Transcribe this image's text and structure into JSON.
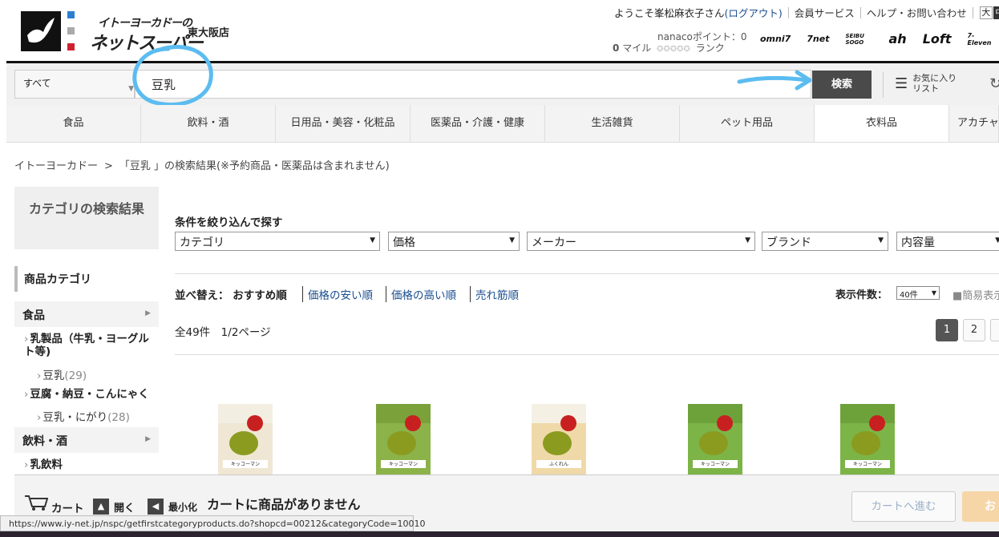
{
  "header": {
    "logo_line1": "イトーヨーカドーの",
    "logo_line2": "ネットスーパー",
    "store": "東大阪店",
    "welcome": "ようこそ峯松麻衣子さん",
    "logout": "(ログアウト)",
    "member": "会員サービス",
    "help": "ヘルプ・お問い合わせ",
    "font_large": "大",
    "font_medium": "中",
    "nanaco": "nanacoポイント：0",
    "miles_value": "0",
    "miles_unit": "マイル",
    "rank": "ランク",
    "partners": [
      "omni7",
      "7net",
      "SEIBU SOGO",
      "ah",
      "Loft",
      "7-Eleven"
    ]
  },
  "search": {
    "scope": "すべて",
    "query": "豆乳",
    "button": "検索",
    "fav_line1": "お気に入り",
    "fav_line2": "リスト"
  },
  "categories": [
    "食品",
    "飲料・酒",
    "日用品・美容・化粧品",
    "医薬品・介護・健康",
    "生活雑貨",
    "ペット用品",
    "衣料品",
    "アカチャン"
  ],
  "active_category": 6,
  "breadcrumb": {
    "home": "イトーヨーカドー",
    "sep": ">",
    "current": "「豆乳 」の検索結果(※予約商品・医薬品は含まれません)"
  },
  "sidebar": {
    "title": "カテゴリの検索結果",
    "head": "商品カテゴリ",
    "food": "食品",
    "dairy": "乳製品（牛乳・ヨーグルト等)",
    "soymilk": "豆乳",
    "soymilk_count": "(29)",
    "tofu": "豆腐・納豆・こんにゃく",
    "nigari": "豆乳・にがり",
    "nigari_count": "(28)",
    "drinks": "飲料・酒",
    "milk_drinks": "乳飲料"
  },
  "filter": {
    "title": "条件を絞り込んで探す",
    "category": "カテゴリ",
    "price": "価格",
    "maker": "メーカー",
    "brand": "ブランド",
    "volume": "内容量"
  },
  "sort": {
    "label": "並べ替え：",
    "current": "おすすめ順",
    "cheap": "価格の安い順",
    "expensive": "価格の高い順",
    "popular": "売れ筋順"
  },
  "per_page": {
    "label": "表示件数：",
    "value": "40件",
    "simple": "■簡易表示"
  },
  "results": {
    "count": "全49件　1/2ページ",
    "pages": [
      "1",
      "2"
    ]
  },
  "products": [
    {
      "label": "キッコーマン",
      "top": "#f2eee2",
      "body": "#efe7d3"
    },
    {
      "label": "キッコーマン",
      "top": "#7aa13a",
      "body": "#8cb24a"
    },
    {
      "label": "ふくれん",
      "top": "#f4f0e4",
      "body": "#f0d9a8"
    },
    {
      "label": "キッコーマン",
      "top": "#6da23a",
      "body": "#7db448"
    },
    {
      "label": "キッコーマン",
      "top": "#6da23a",
      "body": "#7db448"
    }
  ],
  "cart": {
    "label": "カート",
    "open": "開く",
    "minimize": "最小化",
    "empty": "カートに商品がありません",
    "to_cart": "カートへ進む",
    "checkout": "お支"
  },
  "status_url": "https://www.iy-net.jp/nspc/getfirstcategoryproducts.do?shopcd=00212&categoryCode=10010",
  "colors": {
    "accent_link": "#1a4d8f",
    "annotation": "#5bbcf0",
    "search_button": "#4a4a4a"
  }
}
